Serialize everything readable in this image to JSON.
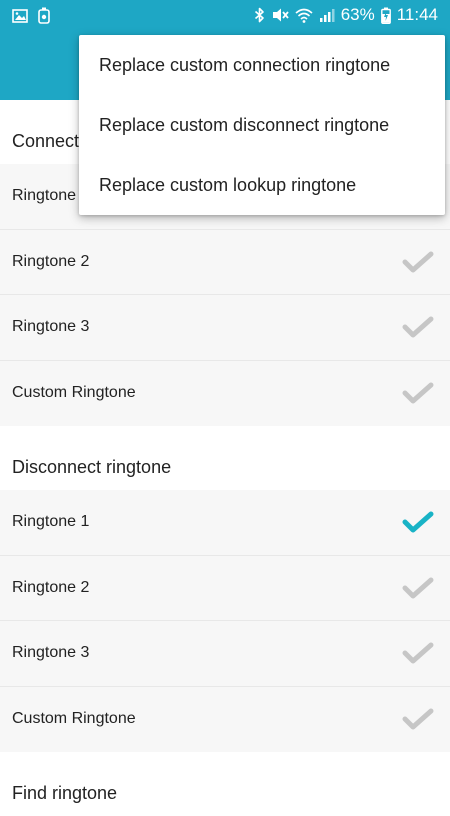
{
  "status_bar": {
    "battery_percent": "63%",
    "time": "11:44",
    "icons": [
      "image-icon",
      "battery-saver-icon",
      "bluetooth-icon",
      "mute-icon",
      "wifi-icon",
      "signal-icon",
      "battery-charging-icon"
    ]
  },
  "menu": {
    "items": [
      {
        "label": "Replace custom connection ringtone"
      },
      {
        "label": "Replace custom disconnect ringtone"
      },
      {
        "label": "Replace custom lookup ringtone"
      }
    ]
  },
  "sections": {
    "connection": {
      "header": "Connect",
      "rows": [
        {
          "label": "Ringtone",
          "checked": false
        },
        {
          "label": "Ringtone 2",
          "checked": false
        },
        {
          "label": "Ringtone 3",
          "checked": false
        },
        {
          "label": "Custom Ringtone",
          "checked": false
        }
      ]
    },
    "disconnect": {
      "header": "Disconnect ringtone",
      "rows": [
        {
          "label": "Ringtone 1",
          "checked": true
        },
        {
          "label": "Ringtone 2",
          "checked": false
        },
        {
          "label": "Ringtone 3",
          "checked": false
        },
        {
          "label": "Custom Ringtone",
          "checked": false
        }
      ]
    },
    "find": {
      "header": "Find ringtone"
    }
  },
  "colors": {
    "accent": "#1ea7c5",
    "check_active": "#19b3c6",
    "check_inactive": "#c6c6c6"
  }
}
